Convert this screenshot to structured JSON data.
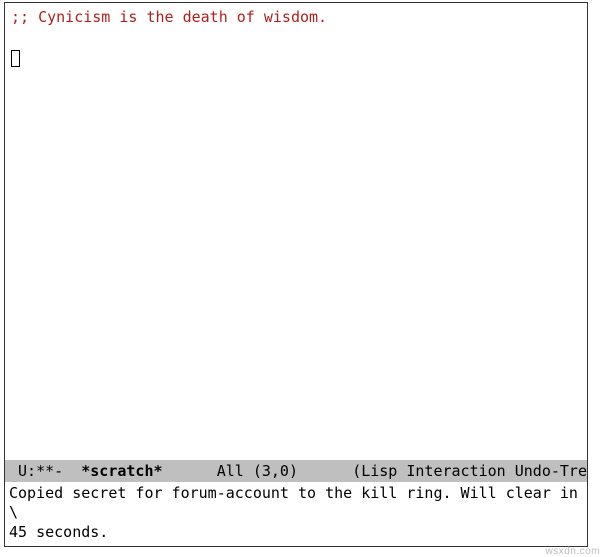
{
  "buffer": {
    "comment_line": ";; Cynicism is the death of wisdom."
  },
  "mode_line": {
    "left": " U:**-  ",
    "buffer_name": "*scratch*",
    "middle": "      All (3,0)      ",
    "modes": "(Lisp Interaction Undo-Tree"
  },
  "minibuffer": {
    "message": "Copied secret for forum-account to the kill ring. Will clear in \\\n45 seconds."
  },
  "watermark": "wsxdn.com"
}
